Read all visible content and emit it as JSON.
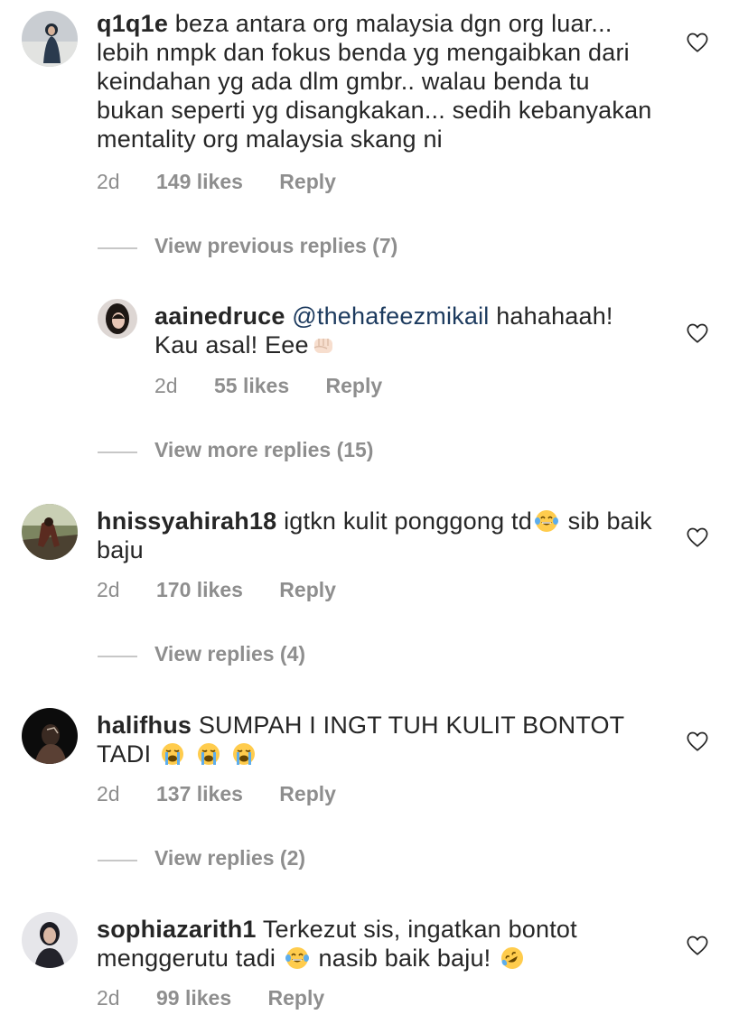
{
  "comments": [
    {
      "username": "q1q1e",
      "text": "beza antara org malaysia dgn org luar... lebih nmpk dan fokus benda yg mengaibkan dari keindahan yg ada dlm gmbr.. walau benda tu bukan seperti yg disangkakan... sedih kebanyakan mentality org malaysia skang ni",
      "time": "2d",
      "likes": "149 likes",
      "reply": "Reply"
    },
    {
      "username": "aainedruce",
      "mention": "@thehafeezmikail",
      "text": "hahahaah! Kau asal! Eee",
      "time": "2d",
      "likes": "55 likes",
      "reply": "Reply"
    },
    {
      "username": "hnissyahirah18",
      "text_a": "igtkn kulit ponggong td",
      "text_b": "sib baik baju",
      "time": "2d",
      "likes": "170 likes",
      "reply": "Reply"
    },
    {
      "username": "halifhus",
      "text": "SUMPAH I INGT TUH KULIT BONTOT TADI",
      "time": "2d",
      "likes": "137 likes",
      "reply": "Reply"
    },
    {
      "username": "sophiazarith1",
      "text_a": "Terkezut sis, ingatkan bontot menggerutu tadi",
      "text_b": "nasib baik baju!",
      "time": "2d",
      "likes": "99 likes",
      "reply": "Reply"
    }
  ],
  "view_links": {
    "previous": "View previous replies (7)",
    "more": "View more replies (15)",
    "replies_4": "View replies (4)",
    "replies_2": "View replies (2)"
  },
  "icons": {
    "like": "heart-outline-icon",
    "fist": "oncoming-fist-emoji",
    "joy": "tears-of-joy-emoji",
    "cry": "loudly-crying-emoji",
    "rofl": "rolling-on-floor-laughing-emoji"
  },
  "colors": {
    "text": "#262626",
    "secondary": "#8e8e8e",
    "mention": "#1c3a5e"
  }
}
